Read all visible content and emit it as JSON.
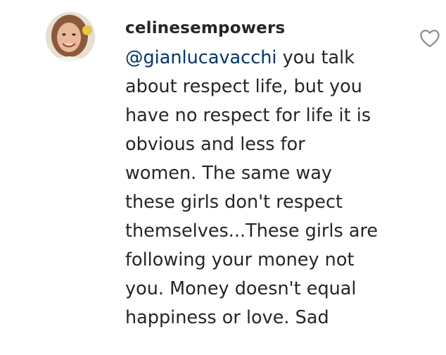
{
  "comment": {
    "username": "celinesempowers",
    "mention": "@gianlucavacchi",
    "lines": [
      " you talk",
      "about respect life, but you",
      "have no respect for life it is",
      "obvious and less for",
      "women. The same way",
      "these girls don't respect",
      "themselves...These girls are",
      "following your money not",
      "you. Money doesn't equal",
      "happiness or love. Sad"
    ]
  },
  "icons": {
    "like": "heart-outline-icon",
    "avatar": "profile-photo"
  },
  "colors": {
    "text": "#262626",
    "mention": "#00376b",
    "icon": "#8e8e8e",
    "background": "#ffffff"
  }
}
